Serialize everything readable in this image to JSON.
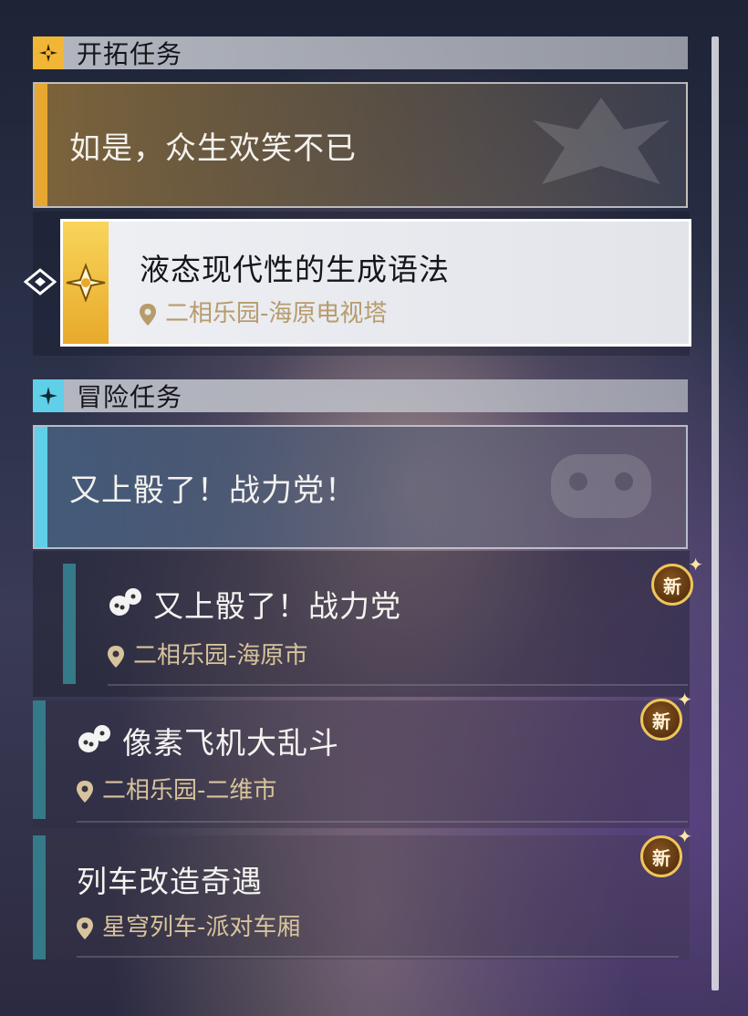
{
  "trailblaze": {
    "header": "开拓任务",
    "header_icon": "trailblaze-star-icon",
    "main_title": "如是，众生欢笑不已",
    "accent_color": "#e7a731",
    "active_quest": {
      "title": "液态现代性的生成语法",
      "location": "二相乐园-海原电视塔"
    }
  },
  "adventure": {
    "header": "冒险任务",
    "header_icon": "adventure-star-icon",
    "accent_color": "#5fd0e8",
    "group_title": "又上骰了！战力党！",
    "quests": [
      {
        "title": "又上骰了！战力党",
        "location": "二相乐园-海原市",
        "badge": "新",
        "icon": "dice-icon"
      },
      {
        "title": "像素飞机大乱斗",
        "location": "二相乐园-二维市",
        "badge": "新",
        "icon": "dice-icon"
      },
      {
        "title": "列车改造奇遇",
        "location": "星穹列车-派对车厢",
        "badge": "新"
      }
    ]
  }
}
